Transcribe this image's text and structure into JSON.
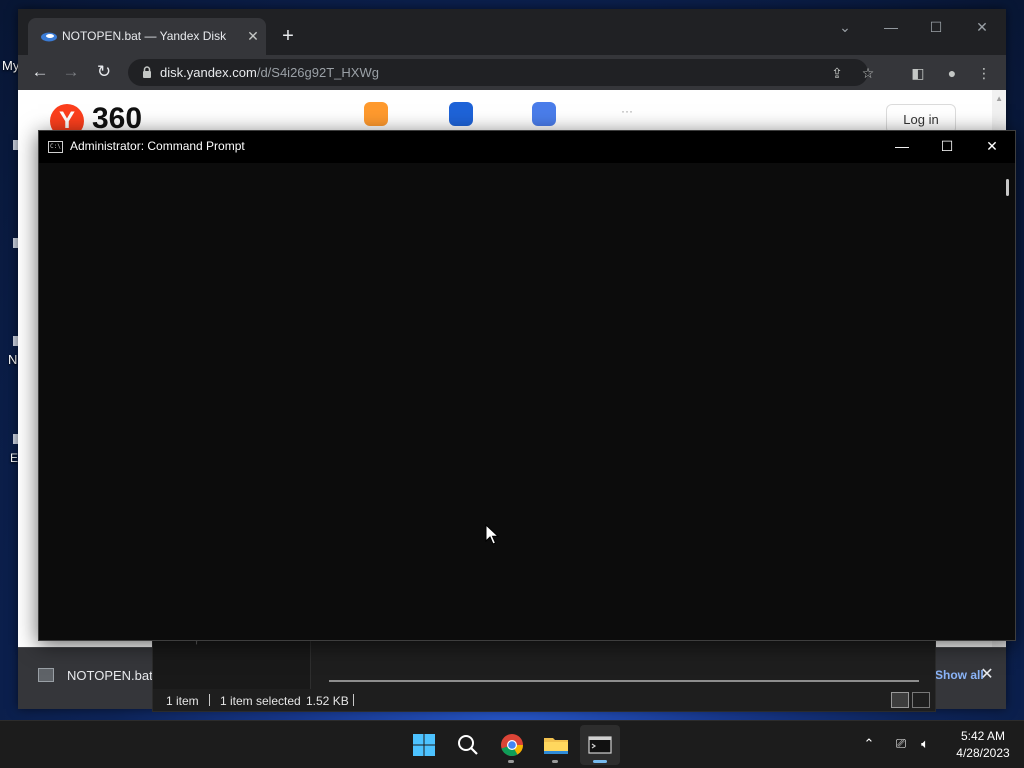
{
  "desktop": {
    "labels": [
      "My",
      "N",
      "E"
    ]
  },
  "browser": {
    "tab": {
      "title": "NOTOPEN.bat — Yandex Disk",
      "close_icon": "close-icon"
    },
    "new_tab_label": "+",
    "url": {
      "host": "disk.yandex.com",
      "path": "/d/S4i26g92T_HXWg"
    },
    "page": {
      "logo_letter": "Y",
      "logo_text": "360",
      "login_label": "Log in",
      "more_apps": "···"
    },
    "download_bar": {
      "filename": "NOTOPEN.bat",
      "show_all": "Show all",
      "close_icon": "close-icon"
    }
  },
  "explorer": {
    "status": {
      "items": "1 item",
      "selected": "1 item selected",
      "size": "1.52 KB"
    }
  },
  "cmd": {
    "icon_text": "C:\\",
    "title": "Administrator:  Command Prompt",
    "minimize": "—",
    "maximize": "☐",
    "close": "✕"
  },
  "taskbar": {
    "apps": [
      "start",
      "search",
      "chrome",
      "file-explorer",
      "command-prompt"
    ],
    "active_app": "command-prompt",
    "clock": {
      "time": "5:42 AM",
      "date": "4/28/2023"
    }
  },
  "colors": {
    "cmd_background": "#0c0c0c",
    "browser_frame": "#202124",
    "taskbar": "#1c1c1c",
    "yandex_red": "#fc3f1d",
    "accent_blue": "#76b9ed"
  }
}
